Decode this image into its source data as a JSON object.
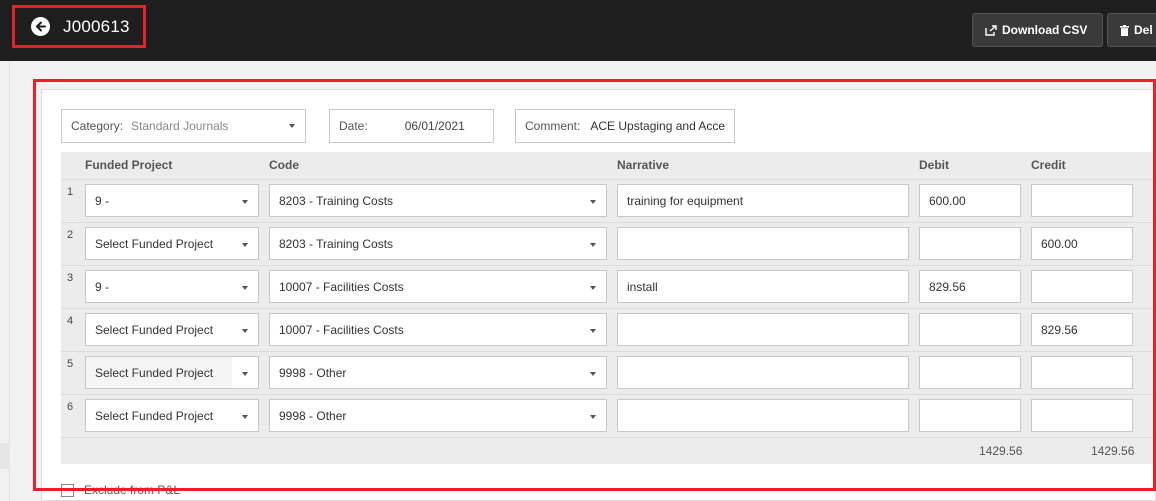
{
  "header": {
    "title": "J000613",
    "back_icon": "arrow-left-circle-icon",
    "download_label": "Download CSV",
    "delete_label": "Del"
  },
  "filters": {
    "category_label": "Category:",
    "category_value": "Standard Journals",
    "date_label": "Date:",
    "date_value": "06/01/2021",
    "comment_label": "Comment:",
    "comment_value": "ACE Upstaging and Acce"
  },
  "columns": {
    "funded_project": "Funded Project",
    "code": "Code",
    "narrative": "Narrative",
    "debit": "Debit",
    "credit": "Credit"
  },
  "rows": [
    {
      "num": "1",
      "funded_project": "9 -",
      "code": "8203 - Training Costs",
      "narrative": "training for equipment",
      "debit": "600.00",
      "credit": ""
    },
    {
      "num": "2",
      "funded_project": "Select Funded Project",
      "code": "8203 - Training Costs",
      "narrative": "",
      "debit": "",
      "credit": "600.00"
    },
    {
      "num": "3",
      "funded_project": "9 -",
      "code": "10007 - Facilities Costs",
      "narrative": "install",
      "debit": "829.56",
      "credit": ""
    },
    {
      "num": "4",
      "funded_project": "Select Funded Project",
      "code": "10007 - Facilities Costs",
      "narrative": "",
      "debit": "",
      "credit": "829.56"
    },
    {
      "num": "5",
      "funded_project": "Select Funded Project",
      "code": "9998 - Other",
      "narrative": "",
      "debit": "",
      "credit": ""
    },
    {
      "num": "6",
      "funded_project": "Select Funded Project",
      "code": "9998 - Other",
      "narrative": "",
      "debit": "",
      "credit": ""
    }
  ],
  "totals": {
    "debit": "1429.56",
    "credit": "1429.56"
  },
  "exclude_label": "Exclude from P&L",
  "colors": {
    "topbar": "#1e1e1e",
    "highlight": "#e8202a",
    "grid_bg": "#ececec"
  }
}
